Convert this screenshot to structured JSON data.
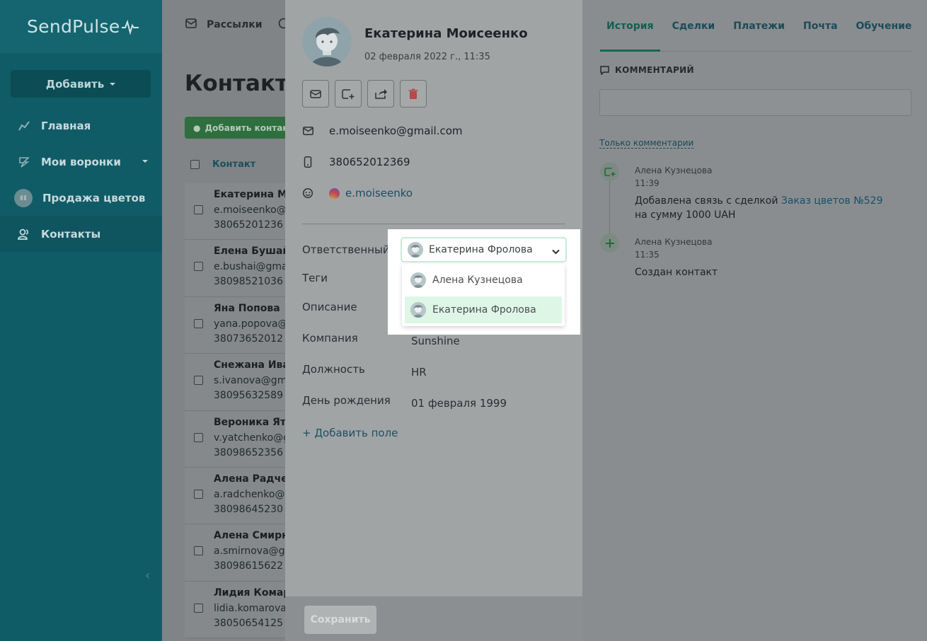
{
  "app": {
    "logo_text": "SendPulse"
  },
  "sidebar": {
    "add_button": "Добавить",
    "items": [
      {
        "label": "Главная",
        "icon": "chart-line-icon"
      },
      {
        "label": "Мои воронки",
        "icon": "funnel-icon"
      },
      {
        "label": "Продажа цветов",
        "icon": "pipeline-avatar-icon"
      },
      {
        "label": "Контакты",
        "icon": "contacts-icon"
      }
    ]
  },
  "topbar": {
    "mailings": "Рассылки"
  },
  "contacts_page": {
    "title": "Контакты",
    "add_contact": "Добавить контакт",
    "column_contact": "Контакт",
    "rows": [
      {
        "name": "Екатерина Мо",
        "email": "e.moiseenko@g",
        "phone": "38065201236"
      },
      {
        "name": "Елена Бушай",
        "email": "e.bushai@gma",
        "phone": "38098521036"
      },
      {
        "name": "Яна Попова",
        "email": "yana.popova@",
        "phone": "38073652012"
      },
      {
        "name": "Снежана Иван",
        "email": "s.ivanova@gm",
        "phone": "38095632589"
      },
      {
        "name": "Вероника Ятч",
        "email": "v.yatchenko@g",
        "phone": "38098652356"
      },
      {
        "name": "Алена Радчен",
        "email": "a.radchenko@g",
        "phone": "38098645230"
      },
      {
        "name": "Алена Смирно",
        "email": "a.smirnova@gn",
        "phone": "38098615622"
      },
      {
        "name": "Лидия Комаро",
        "email": "lidia.komarova@",
        "phone": "38050654125"
      }
    ]
  },
  "contact": {
    "name": "Екатерина Моисеенко",
    "created": "02 февраля 2022 г., 11:35",
    "email": "e.moiseenko@gmail.com",
    "phone": "380652012369",
    "instagram": "e.moiseenko",
    "fields": {
      "responsible_label": "Ответственный",
      "tags_label": "Теги",
      "description_label": "Описание",
      "company_label": "Компания",
      "company_value": "Sunshine",
      "position_label": "Должность",
      "position_value": "HR",
      "birthday_label": "День рождения",
      "birthday_value": "01 февраля 1999"
    },
    "add_field": "+ Добавить поле",
    "save": "Сохранить"
  },
  "responsible_select": {
    "value": "Екатерина Фролова",
    "options": [
      "Алена Кузнецова",
      "Екатерина Фролова"
    ],
    "selected_index": 1
  },
  "history": {
    "tabs": [
      "История",
      "Сделки",
      "Платежи",
      "Почта",
      "Обучение"
    ],
    "active_tab": 0,
    "comment_heading": "КОММЕНТАРИЙ",
    "filter": "Только комментарии",
    "events": [
      {
        "author": "Алена Кузнецова",
        "time": "11:39",
        "text_before": "Добавлена связь с сделкой ",
        "link": "Заказ цветов №529",
        "text_after": " на сумму 1000 UAH"
      },
      {
        "author": "Алена Кузнецова",
        "time": "11:35",
        "text": "Создан контакт"
      }
    ]
  }
}
